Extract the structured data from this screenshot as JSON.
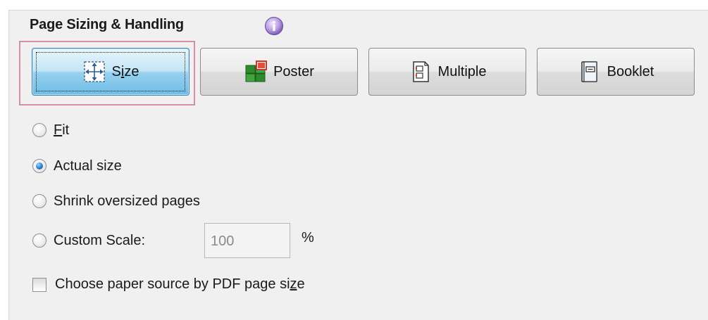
{
  "section": {
    "title": "Page Sizing & Handling"
  },
  "icons": {
    "info": "info-icon",
    "size": "size-arrows-icon",
    "poster": "poster-tiles-icon",
    "multiple": "multiple-pages-icon",
    "booklet": "booklet-icon"
  },
  "colors": {
    "selected_button": "#98d1ef",
    "highlight_frame": "#d98ab1",
    "radio_checked": "#2a7cd0"
  },
  "mode_buttons": {
    "size": {
      "label_prefix": "S",
      "label_underlined": "i",
      "label_suffix": "ze",
      "selected": true
    },
    "poster": {
      "label": "Poster",
      "selected": false
    },
    "multiple": {
      "label": "Multiple",
      "selected": false
    },
    "booklet": {
      "label": "Booklet",
      "selected": false
    }
  },
  "options": {
    "fit": {
      "label_underlined": "F",
      "label_rest": "it",
      "checked": false
    },
    "actual_size": {
      "label": "Actual size",
      "checked": true
    },
    "shrink": {
      "label": "Shrink oversized pages",
      "checked": false
    },
    "custom_scale": {
      "label": "Custom Scale:",
      "checked": false,
      "value": "100",
      "unit": "%"
    }
  },
  "checkbox": {
    "label_prefix": "Choose paper source by PDF page si",
    "label_underlined": "z",
    "label_suffix": "e",
    "checked": false
  }
}
